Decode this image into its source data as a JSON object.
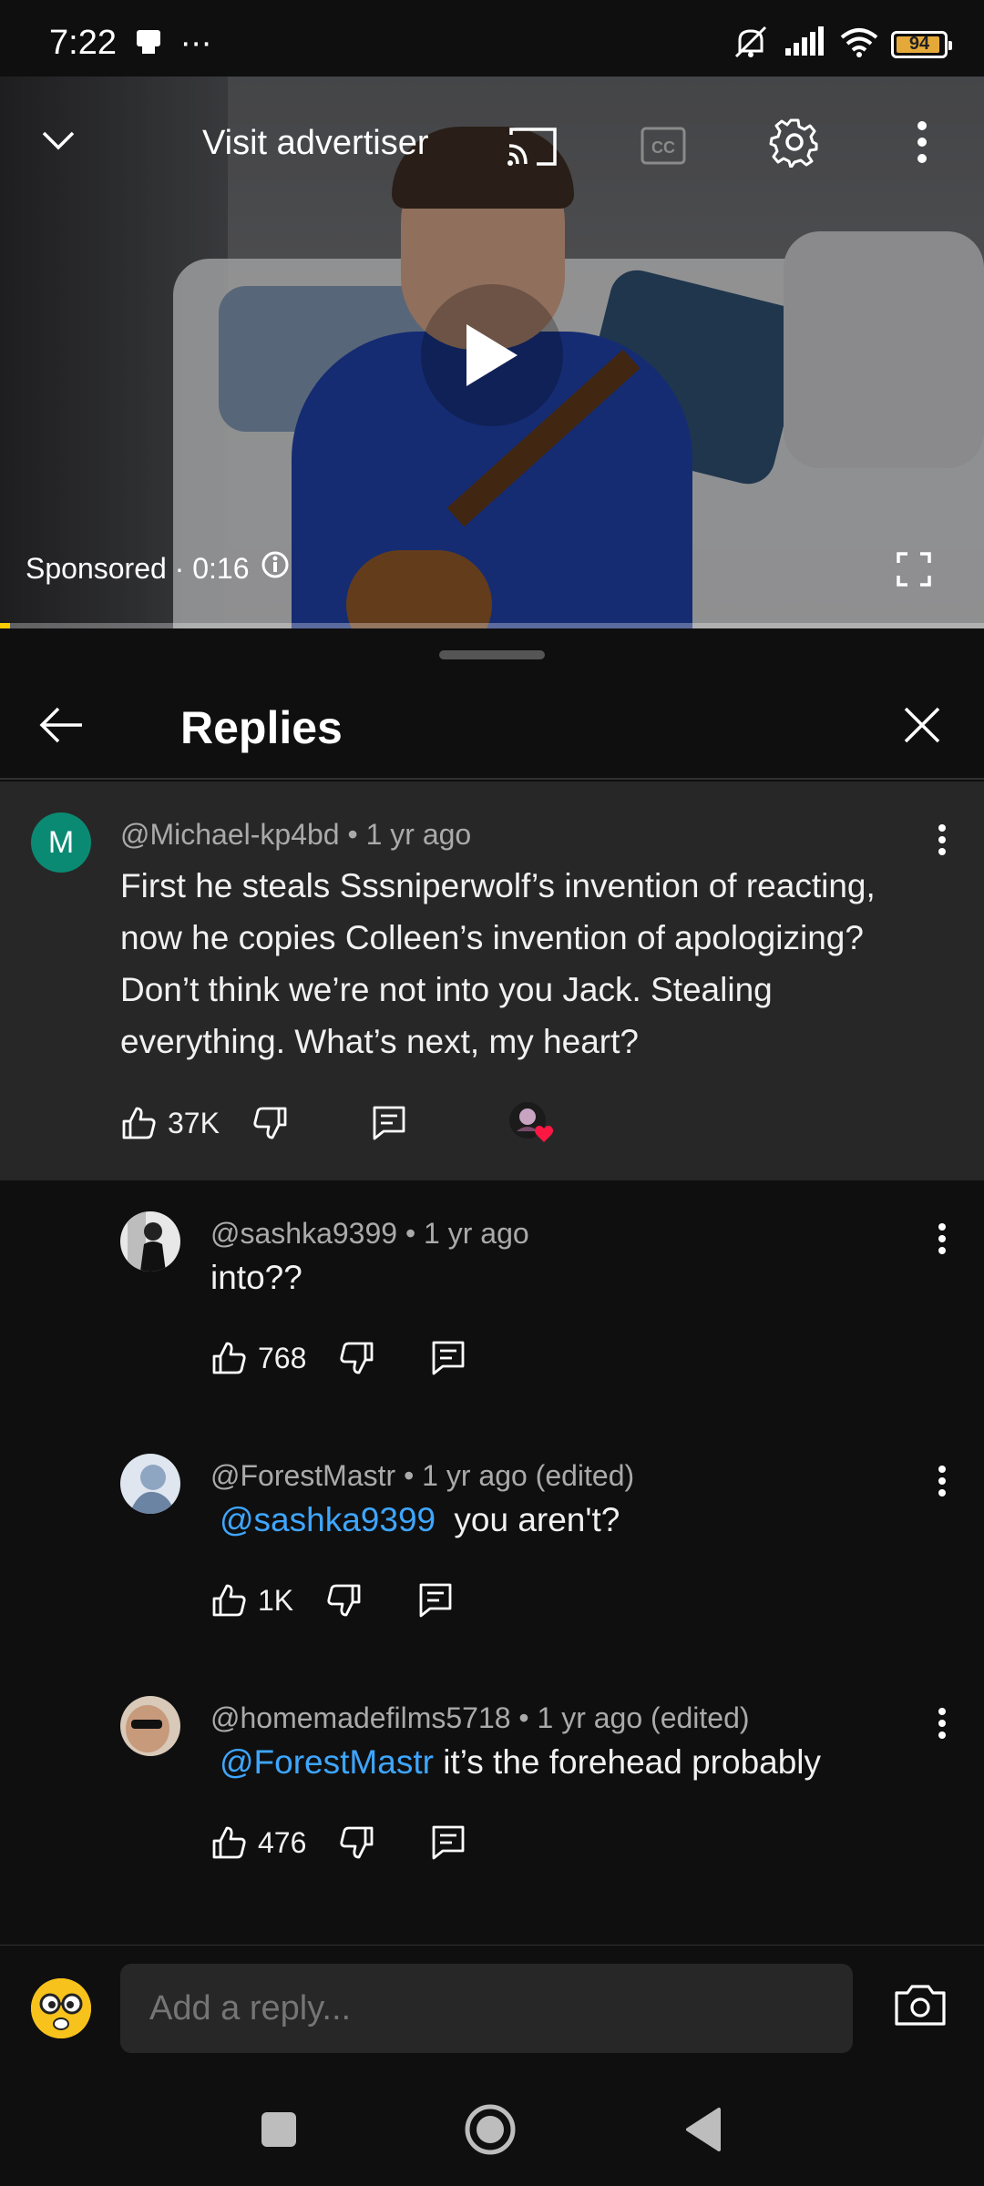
{
  "status_bar": {
    "time": "7:22",
    "extra_icon": "⋯",
    "battery_level": "94",
    "battery_fraction": 0.94,
    "battery_color": "#e5a93a"
  },
  "video": {
    "visit_advertiser_label": "Visit advertiser",
    "sponsored_label": "Sponsored · 0:16",
    "progress_fraction": 0.01,
    "progress_color": "#ffcc00"
  },
  "replies_panel": {
    "title": "Replies",
    "parent_comment": {
      "avatar_letter": "M",
      "avatar_color": "#0b8a73",
      "meta": "@Michael-kp4bd • 1 yr ago",
      "text": "First he steals Sssniperwolf’s invention of reacting, now he copies Colleen’s invention of apologizing? Don’t think we’re not into you Jack. Stealing everything. What’s next, my heart?",
      "likes": "37K"
    },
    "replies": [
      {
        "meta": "@sashka9399 • 1 yr ago",
        "mention": "",
        "text": "into??",
        "likes": "768"
      },
      {
        "meta": "@ForestMastr • 1 yr ago (edited)",
        "mention": "@sashka9399",
        "text": "you aren't?",
        "likes": "1K"
      },
      {
        "meta": "@homemadefilms5718 • 1 yr ago (edited)",
        "mention": "@ForestMastr",
        "text": "it’s the forehead probably",
        "likes": "476"
      }
    ]
  },
  "reply_bar": {
    "placeholder": "Add a reply..."
  },
  "colors": {
    "background": "#0f0f0f",
    "highlight_background": "#272727",
    "mention": "#3ea6ff"
  }
}
